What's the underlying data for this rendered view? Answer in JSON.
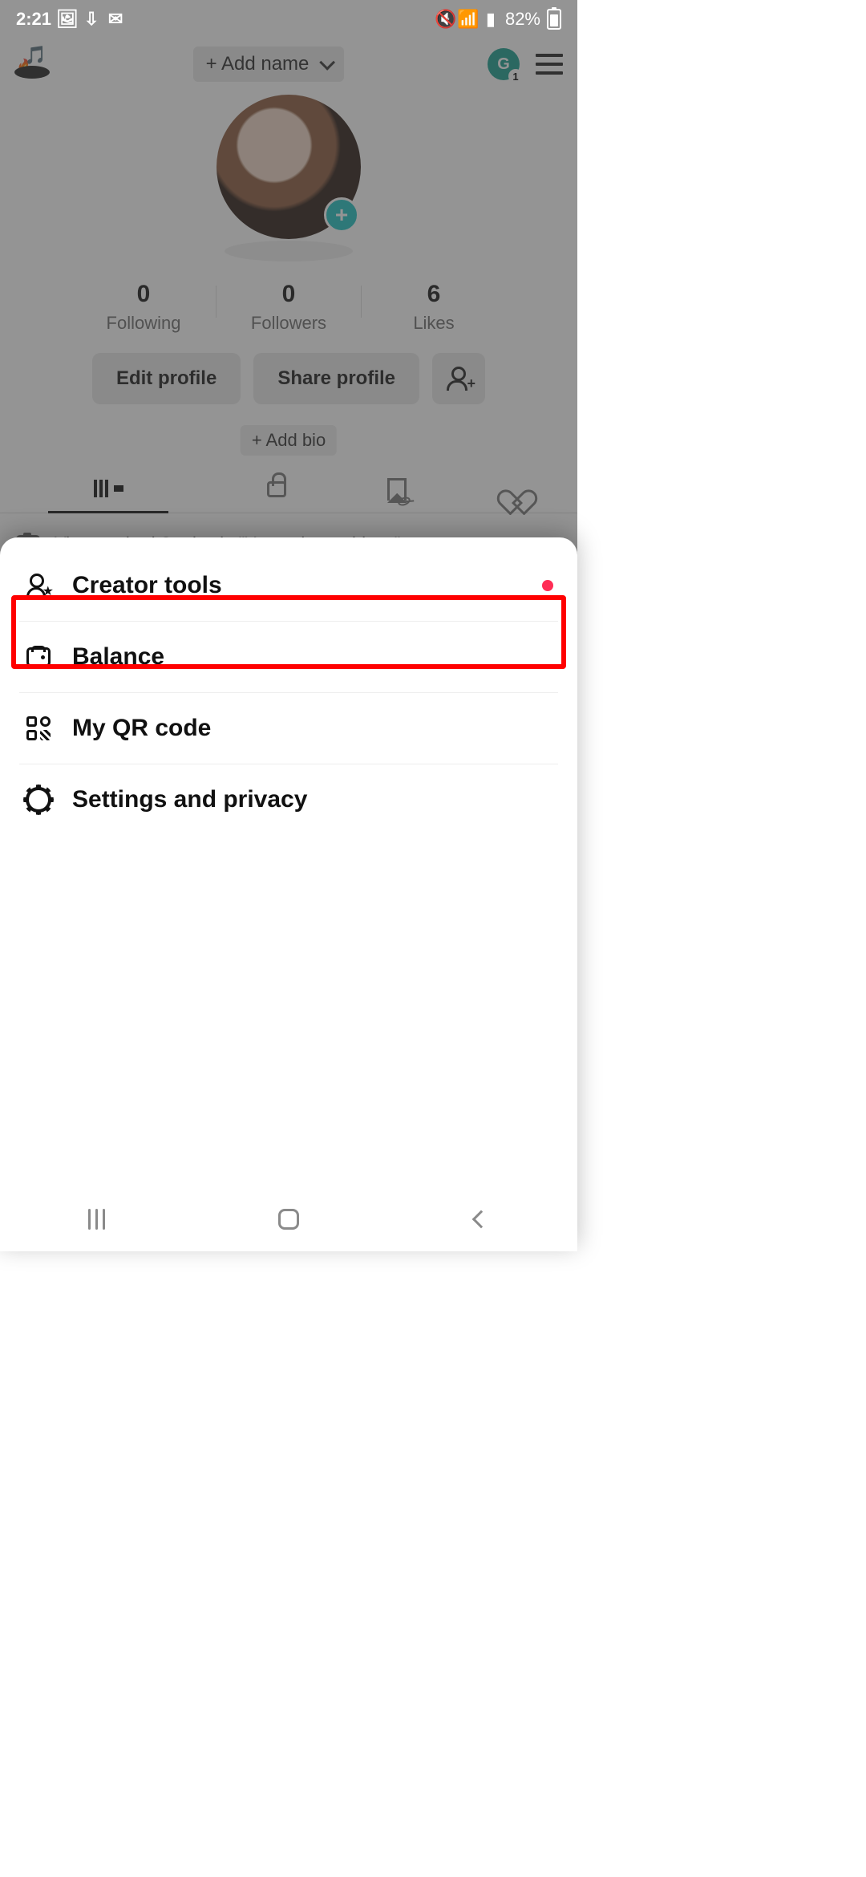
{
  "status": {
    "time": "2:21",
    "battery_pct": "82%"
  },
  "header": {
    "add_name": "+ Add name",
    "avatar_letter": "G",
    "avatar_badge": "1"
  },
  "stats": {
    "following": {
      "count": "0",
      "label": "Following"
    },
    "followers": {
      "count": "0",
      "label": "Followers"
    },
    "likes": {
      "count": "6",
      "label": "Likes"
    }
  },
  "buttons": {
    "edit": "Edit profile",
    "share": "Share profile",
    "add_bio": "+ Add bio"
  },
  "banner": {
    "text": "View expired Stories in \"Your private videos\""
  },
  "menu": {
    "creator_tools": "Creator tools",
    "balance": "Balance",
    "qr": "My QR code",
    "settings": "Settings and privacy"
  }
}
